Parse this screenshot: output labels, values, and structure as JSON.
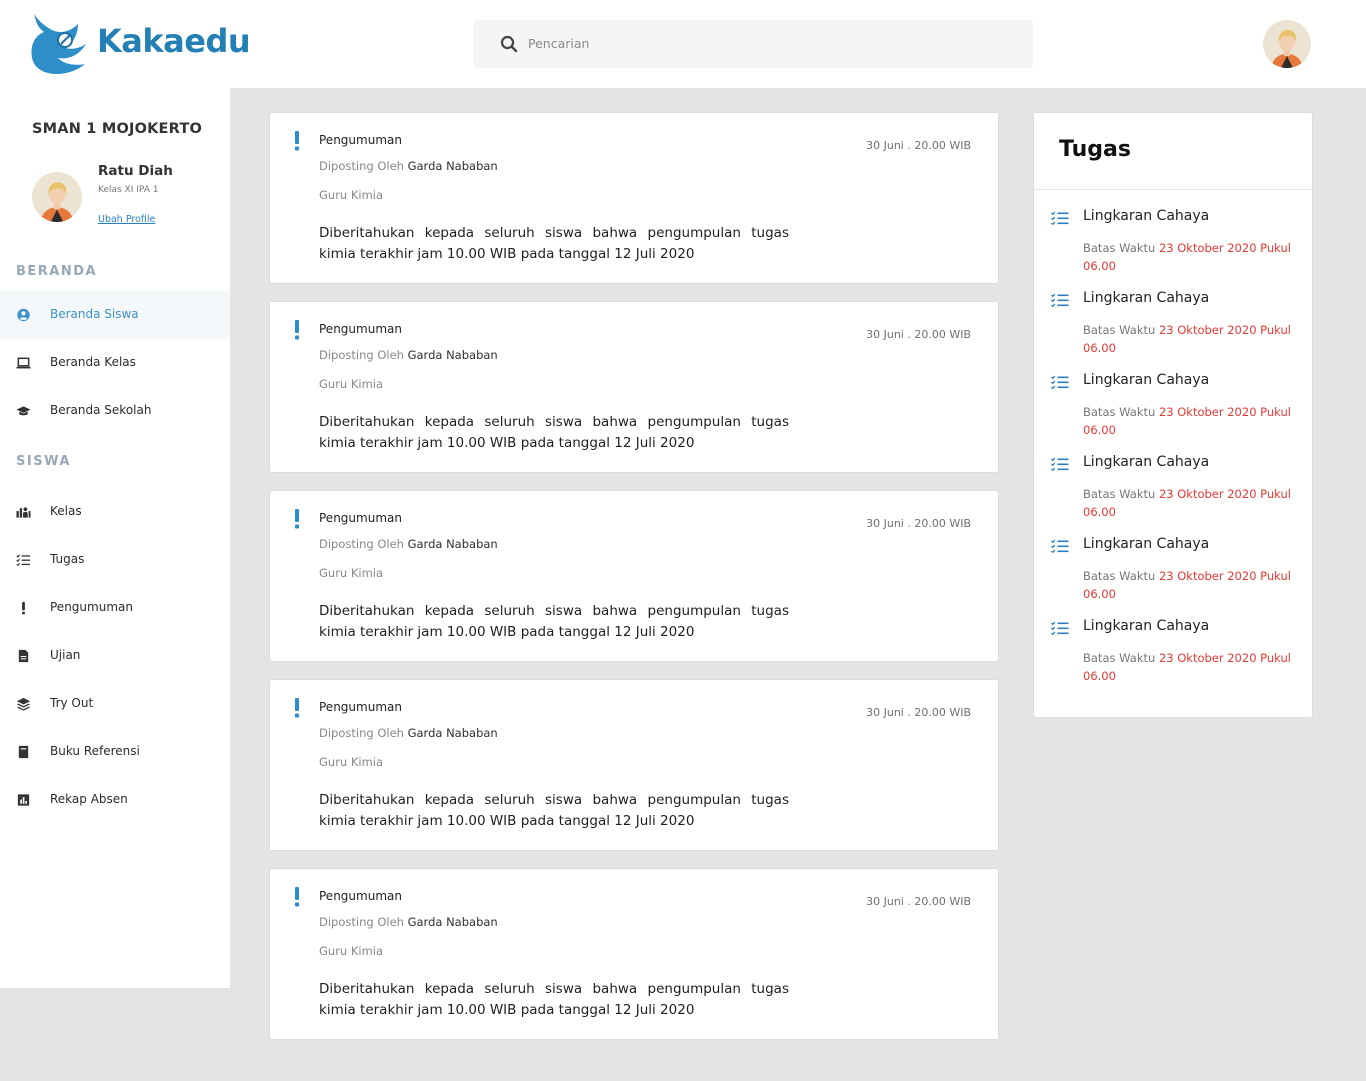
{
  "header": {
    "brand": "Kakaedu",
    "search_placeholder": "Pencarian"
  },
  "profile": {
    "school": "SMAN 1 MOJOKERTO",
    "name": "Ratu Diah",
    "class": "Kelas XI IPA 1",
    "edit_link": "Ubah Profile"
  },
  "nav": {
    "beranda_label": "BERANDA",
    "beranda_items": [
      {
        "label": "Beranda Siswa",
        "icon": "user-circle-icon",
        "active": true
      },
      {
        "label": "Beranda Kelas",
        "icon": "laptop-icon",
        "active": false
      },
      {
        "label": "Beranda Sekolah",
        "icon": "graduation-cap-icon",
        "active": false
      }
    ],
    "siswa_label": "SISWA",
    "siswa_items": [
      {
        "label": "Kelas",
        "icon": "classroom-icon"
      },
      {
        "label": "Tugas",
        "icon": "task-list-icon"
      },
      {
        "label": "Pengumuman",
        "icon": "exclamation-icon"
      },
      {
        "label": "Ujian",
        "icon": "document-icon"
      },
      {
        "label": "Try Out",
        "icon": "layers-icon"
      },
      {
        "label": "Buku Referensi",
        "icon": "book-icon"
      },
      {
        "label": "Rekap Absen",
        "icon": "chart-icon"
      }
    ]
  },
  "announcements": [
    {
      "title": "Pengumuman",
      "date": "30 Juni . 20.00 WIB",
      "posted_by_prefix": "Diposting Oleh",
      "author": "Garda Nababan",
      "role": "Guru Kimia",
      "body": "Diberitahukan kepada seluruh siswa bahwa pengumpulan tugas kimia terakhir jam 10.00 WIB pada tanggal 12 Juli 2020"
    },
    {
      "title": "Pengumuman",
      "date": "30 Juni . 20.00 WIB",
      "posted_by_prefix": "Diposting Oleh",
      "author": "Garda Nababan",
      "role": "Guru Kimia",
      "body": "Diberitahukan kepada seluruh siswa bahwa pengumpulan tugas kimia terakhir jam 10.00 WIB pada tanggal 12 Juli 2020"
    },
    {
      "title": "Pengumuman",
      "date": "30 Juni . 20.00 WIB",
      "posted_by_prefix": "Diposting Oleh",
      "author": "Garda Nababan",
      "role": "Guru Kimia",
      "body": "Diberitahukan kepada seluruh siswa bahwa pengumpulan tugas kimia terakhir jam 10.00 WIB pada tanggal 12 Juli 2020"
    },
    {
      "title": "Pengumuman",
      "date": "30 Juni . 20.00 WIB",
      "posted_by_prefix": "Diposting Oleh",
      "author": "Garda Nababan",
      "role": "Guru Kimia",
      "body": "Diberitahukan kepada seluruh siswa bahwa pengumpulan tugas kimia terakhir jam 10.00 WIB pada tanggal 12 Juli 2020"
    },
    {
      "title": "Pengumuman",
      "date": "30 Juni . 20.00 WIB",
      "posted_by_prefix": "Diposting Oleh",
      "author": "Garda Nababan",
      "role": "Guru Kimia",
      "body": "Diberitahukan kepada seluruh siswa bahwa pengumpulan tugas kimia terakhir jam 10.00 WIB pada tanggal 12 Juli 2020"
    }
  ],
  "tugas": {
    "title": "Tugas",
    "items": [
      {
        "name": "Lingkaran Cahaya",
        "deadline_prefix": "Batas Waktu",
        "deadline": "23 Oktober 2020 Pukul 06.00"
      },
      {
        "name": "Lingkaran Cahaya",
        "deadline_prefix": "Batas Waktu",
        "deadline": "23 Oktober 2020 Pukul 06.00"
      },
      {
        "name": "Lingkaran Cahaya",
        "deadline_prefix": "Batas Waktu",
        "deadline": "23 Oktober 2020 Pukul 06.00"
      },
      {
        "name": "Lingkaran Cahaya",
        "deadline_prefix": "Batas Waktu",
        "deadline": "23 Oktober 2020 Pukul 06.00"
      },
      {
        "name": "Lingkaran Cahaya",
        "deadline_prefix": "Batas Waktu",
        "deadline": "23 Oktober 2020 Pukul 06.00"
      },
      {
        "name": "Lingkaran Cahaya",
        "deadline_prefix": "Batas Waktu",
        "deadline": "23 Oktober 2020 Pukul 06.00"
      }
    ]
  },
  "colors": {
    "brand": "#2480b4",
    "active_nav": "#3d92cc",
    "deadline": "#e53935",
    "background": "#e4e4e4"
  }
}
